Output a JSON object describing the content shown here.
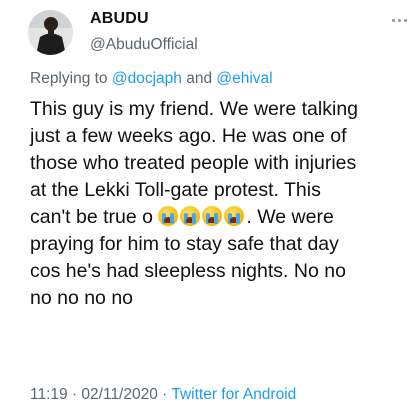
{
  "tweet": {
    "author": {
      "name": "ABUDU",
      "handle": "@AbuduOfficial"
    },
    "replying_prefix": "Replying to ",
    "mentions": [
      "@docjaph",
      "@ehival"
    ],
    "mention_joiner": " and ",
    "body_lines": [
      "This guy is my friend. We were talking",
      "just a few weeks ago. He was one of",
      "those who treated people with injuries",
      "at the Lekki Toll-gate protest. This",
      "can't be true o",
      ". We were",
      "praying for him to stay safe that day",
      "cos he's had sleepless nights. No no",
      "no no no no"
    ],
    "emoji_name": "loudly-crying-face-emoji",
    "emoji_count": 4,
    "time": "11:19",
    "date": "02/11/2020",
    "separator": " · ",
    "source": "Twitter for Android"
  },
  "colors": {
    "text": "#111111",
    "muted": "#5b6670",
    "link": "#1d9bf0",
    "background": "#ffffff"
  }
}
